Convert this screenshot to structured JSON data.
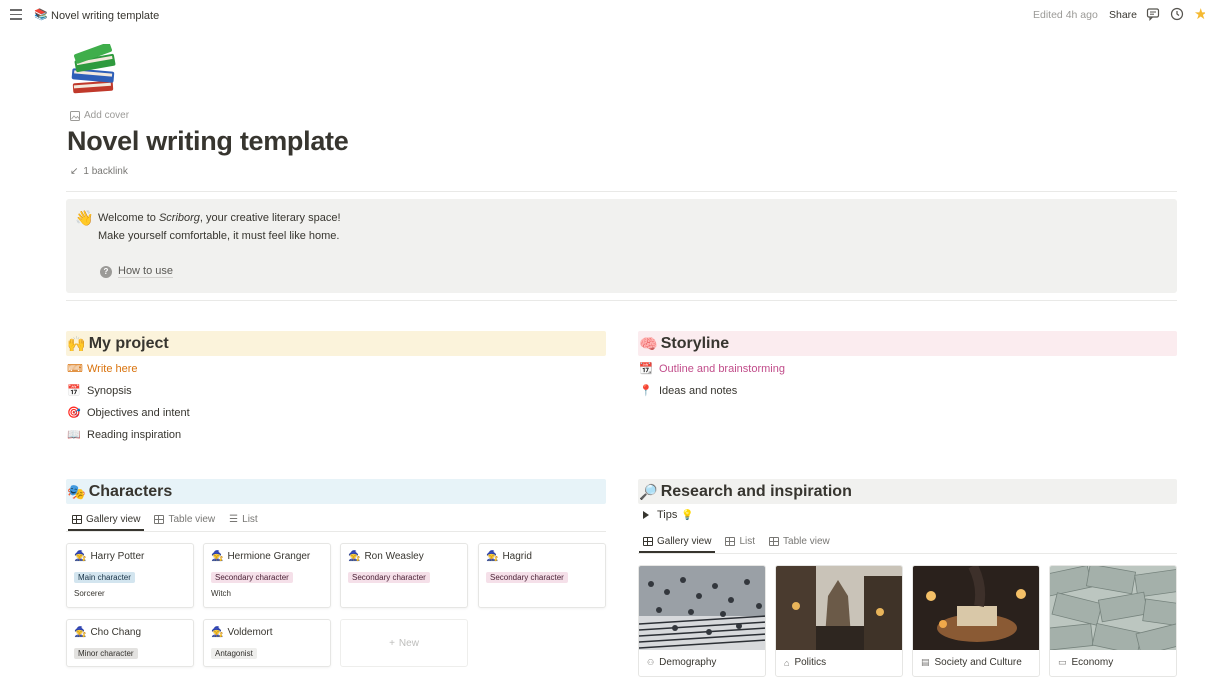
{
  "topbar": {
    "page_title": "Novel writing template",
    "edited": "Edited 4h ago",
    "share": "Share"
  },
  "header": {
    "add_cover": "Add cover",
    "title": "Novel writing template",
    "backlink": "1 backlink"
  },
  "callout": {
    "line1_pre": "Welcome to ",
    "line1_em": "Scriborg",
    "line1_post": ", your creative literary space!",
    "line2": "Make yourself comfortable, it must feel like home.",
    "how_to_use": "How to use"
  },
  "my_project": {
    "heading": "My project",
    "items": [
      {
        "label": "Write here",
        "icon": "keyboard-icon"
      },
      {
        "label": "Synopsis",
        "icon": "calendar-icon"
      },
      {
        "label": "Objectives and intent",
        "icon": "target-icon"
      },
      {
        "label": "Reading inspiration",
        "icon": "book-icon"
      }
    ]
  },
  "storyline": {
    "heading": "Storyline",
    "items": [
      {
        "label": "Outline and brainstorming",
        "icon": "calendar-icon"
      },
      {
        "label": "Ideas and notes",
        "icon": "pin-icon"
      }
    ]
  },
  "characters": {
    "heading": "Characters",
    "tabs": [
      "Gallery view",
      "Table view",
      "List"
    ],
    "cards": [
      {
        "name": "Harry Potter",
        "tag": "Main character",
        "sub": "Sorcerer"
      },
      {
        "name": "Hermione Granger",
        "tag": "Secondary character",
        "sub": "Witch"
      },
      {
        "name": "Ron Weasley",
        "tag": "Secondary character",
        "sub": ""
      },
      {
        "name": "Hagrid",
        "tag": "Secondary character",
        "sub": ""
      },
      {
        "name": "Cho Chang",
        "tag": "Minor character",
        "sub": ""
      },
      {
        "name": "Voldemort",
        "tag": "Antagonist",
        "sub": ""
      }
    ],
    "new_label": "New"
  },
  "research": {
    "heading": "Research and inspiration",
    "tips": "Tips",
    "tabs": [
      "Gallery view",
      "List",
      "Table view"
    ],
    "cards": [
      "Demography",
      "Politics",
      "Society and Culture",
      "Economy"
    ]
  },
  "colors": {
    "my_project_bg": "#fbf3db",
    "storyline_bg": "#fbecef",
    "characters_bg": "#e7f3f8",
    "research_bg": "#f1f1ef",
    "orange_link": "#d9730d",
    "pink_link": "#c14c8a",
    "tag_main": "#d3e5ef",
    "tag_secondary": "#f5e0e9",
    "tag_minor": "#e3e2e0",
    "tag_antagonist": "#eeeeec"
  }
}
